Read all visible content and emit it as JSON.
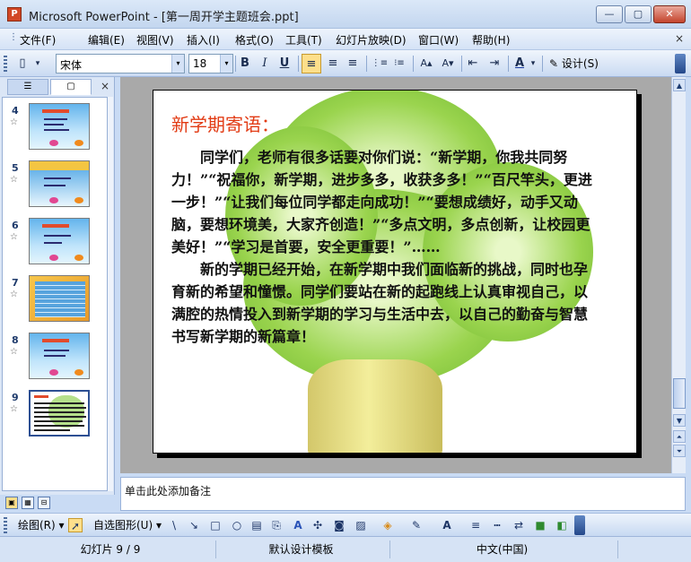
{
  "window": {
    "app_icon": "P",
    "title": "Microsoft PowerPoint - [第一周开学主题班会.ppt]",
    "controls": [
      "minimize-icon",
      "maximize-icon",
      "close-icon"
    ],
    "minimize_glyph": "—",
    "maximize_glyph": "▢",
    "close_glyph": "✕"
  },
  "menu": {
    "items": [
      "文件(F)",
      "编辑(E)",
      "视图(V)",
      "插入(I)",
      "格式(O)",
      "工具(T)",
      "幻灯片放映(D)",
      "窗口(W)",
      "帮助(H)"
    ],
    "close_glyph": "×"
  },
  "toolbar": {
    "font_name": "宋体",
    "font_size": "18",
    "bold": "B",
    "italic": "I",
    "underline": "U",
    "align_left": "≡",
    "align_center": "≡",
    "align_right": "≡",
    "numbered_list": "⋮≡",
    "bullet_list": "⁝≡",
    "grow_font": "A▴",
    "shrink_font": "A▾",
    "decrease_indent": "⇤",
    "increase_indent": "⇥",
    "font_color": "A",
    "design_label": "设计(S)",
    "new_glyph": "▯",
    "dropdown_glyph": "▾"
  },
  "left_pane": {
    "tab_outline_glyph": "☰",
    "tab_slides_glyph": "▢",
    "close_glyph": "×",
    "thumbnails": [
      {
        "number": "4",
        "star": "☆"
      },
      {
        "number": "5",
        "star": "☆"
      },
      {
        "number": "6",
        "star": "☆"
      },
      {
        "number": "7",
        "star": "☆"
      },
      {
        "number": "8",
        "star": "☆"
      },
      {
        "number": "9",
        "star": "☆"
      }
    ]
  },
  "slide": {
    "title": "新学期寄语：",
    "paragraph1": "同学们，老师有很多话要对你们说：“新学期，你我共同努力！”“祝福你，新学期，进步多多，收获多多！”“百尺竿头，更进一步！”“让我们每位同学都走向成功！”“要想成绩好，动手又动脑，要想环境美，大家齐创造！”“多点文明，多点创新，让校园更美好！”“学习是首要，安全更重要！”……",
    "paragraph2": "新的学期已经开始，在新学期中我们面临新的挑战，同时也孕育新的希望和憧憬。同学们要站在新的起跑线上认真审视自己，以满腔的热情投入到新学期的学习与生活中去，以自己的勤奋与智慧书写新学期的新篇章！"
  },
  "scrollbar": {
    "up_glyph": "▲",
    "down_glyph": "▼",
    "prev_slide_glyph": "⏶",
    "next_slide_glyph": "⏷"
  },
  "notes": {
    "placeholder": "单击此处添加备注"
  },
  "view_buttons": [
    "▣",
    "▦",
    "⊟"
  ],
  "draw_toolbar": {
    "draw_label": "绘图(R)",
    "autoshapes_label": "自选图形(U)",
    "tools": [
      "\\",
      "↘",
      "□",
      "○",
      "▤",
      "⎘",
      "A",
      "✣",
      "◙",
      "▨",
      "◈",
      "✎",
      "A",
      "≡",
      "┅",
      "⇄",
      "■",
      "◧"
    ]
  },
  "statusbar": {
    "slide_info": "幻灯片 9 / 9",
    "template": "默认设计模板",
    "language": "中文(中国)"
  }
}
